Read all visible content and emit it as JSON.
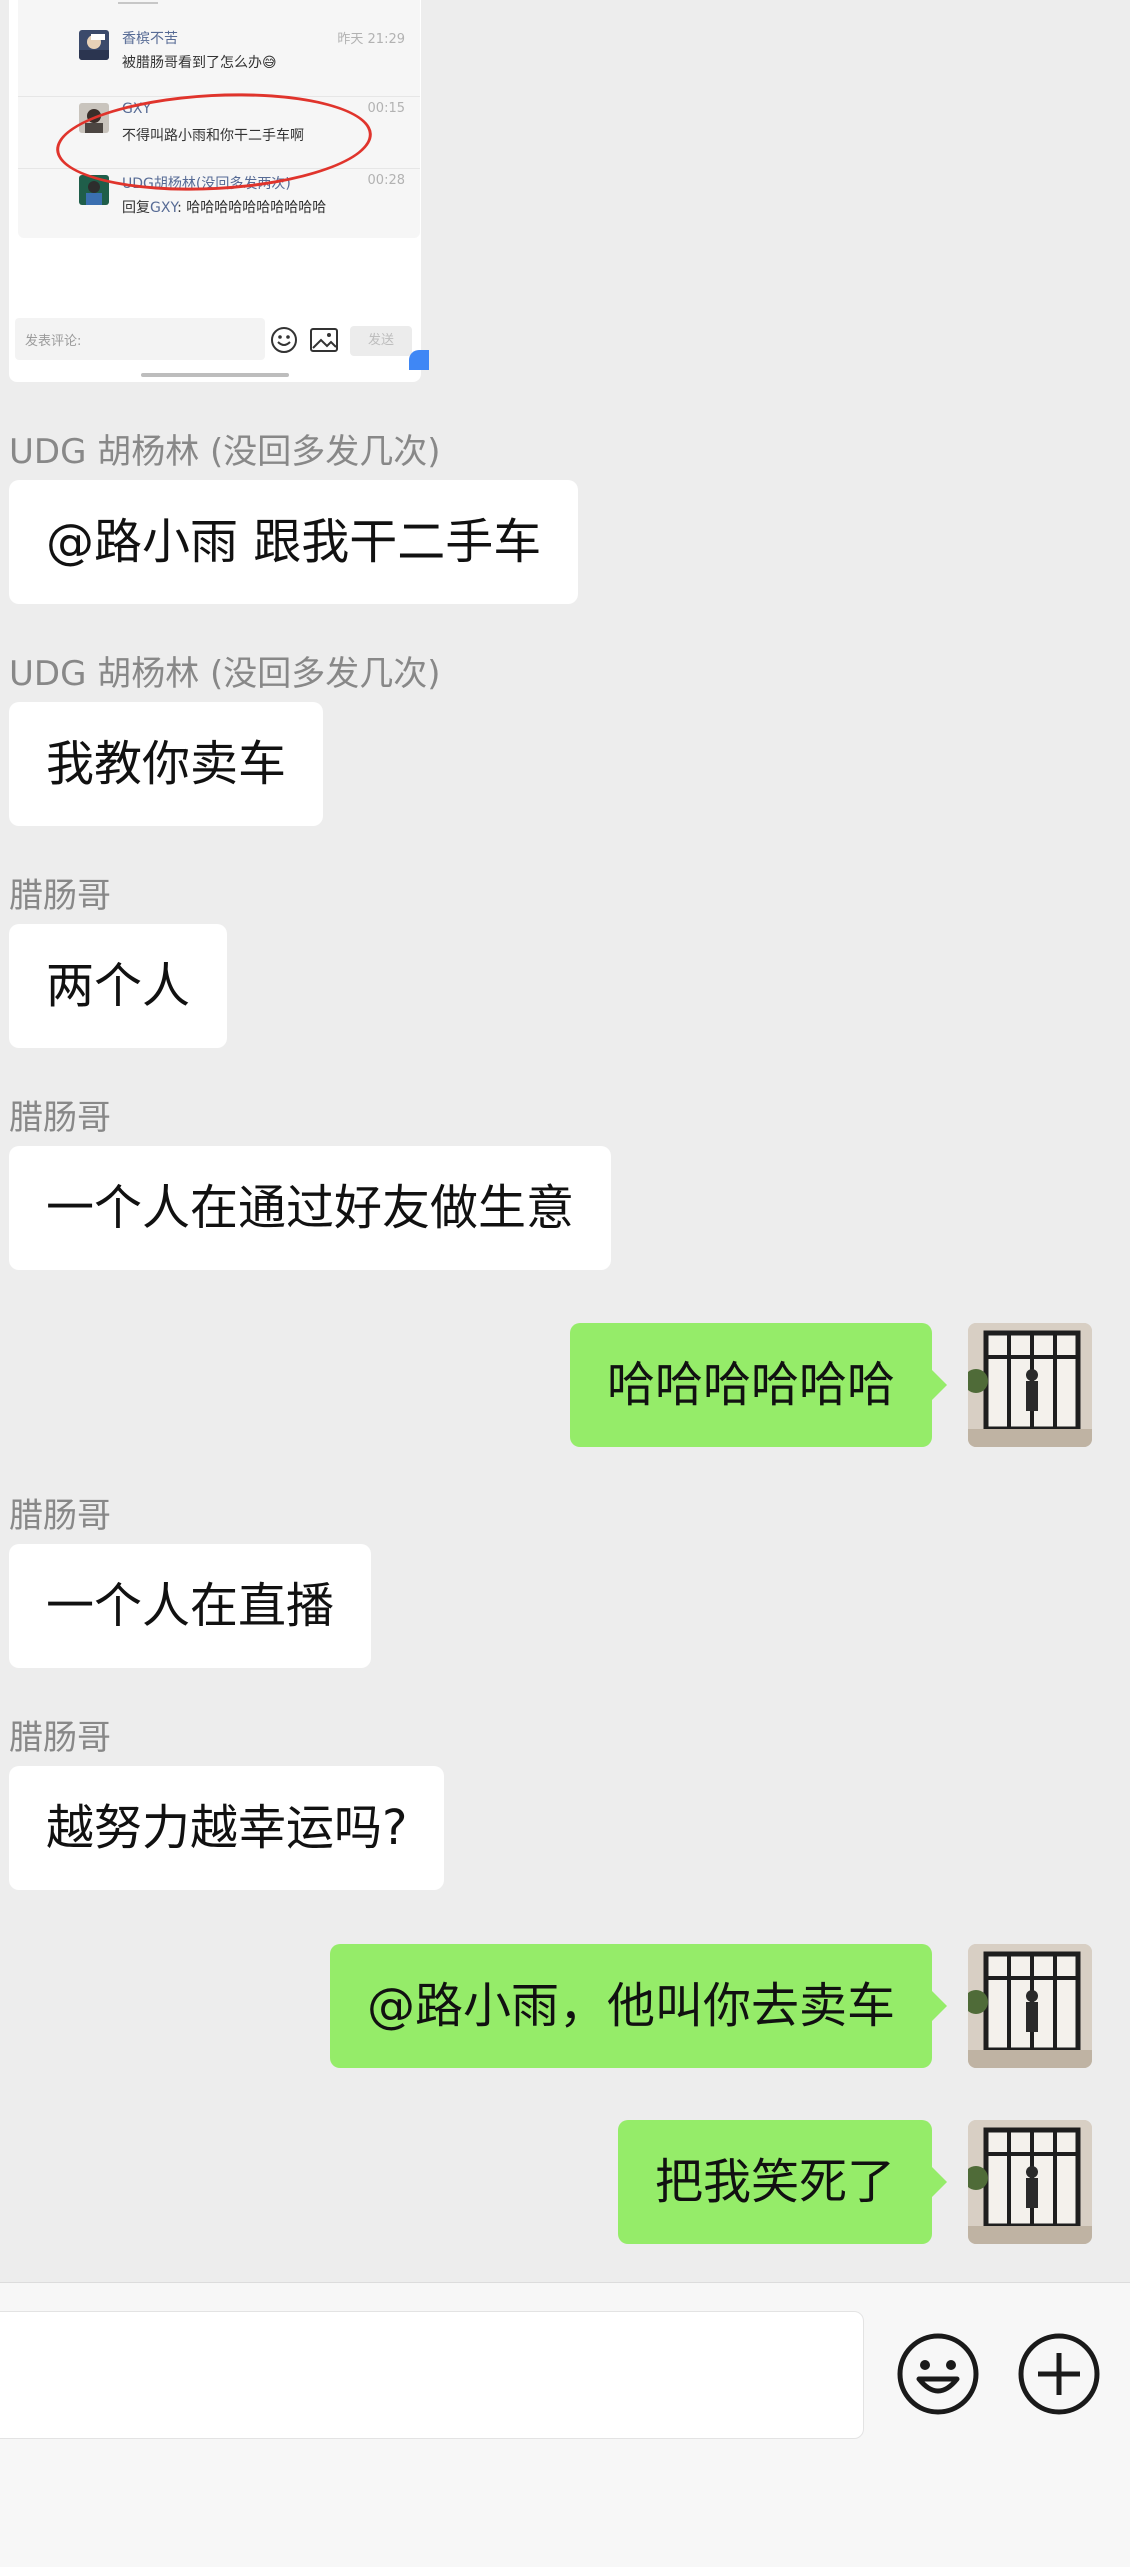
{
  "embedded_screenshot": {
    "comments": [
      {
        "name": "香槟不苦",
        "time": "昨天 21:29",
        "text": "被腊肠哥看到了怎么办😅"
      },
      {
        "name": "GXY",
        "time": "00:15",
        "text": "不得叫路小雨和你干二手车啊"
      },
      {
        "name": "UDG胡杨林(没回多发两次)",
        "time": "00:28",
        "reply_prefix": "回复",
        "reply_name": "GXY",
        "reply_text": ": 哈哈哈哈哈哈哈哈哈哈"
      }
    ],
    "input_placeholder": "发表评论:",
    "send_label": "发送"
  },
  "messages": [
    {
      "sender": "UDG 胡杨林 (没回多发几次)",
      "text": "@路小雨 跟我干二手车"
    },
    {
      "sender": "UDG 胡杨林 (没回多发几次)",
      "text": "我教你卖车"
    },
    {
      "sender": "腊肠哥",
      "text": "两个人"
    },
    {
      "sender": "腊肠哥",
      "text": "一个人在通过好友做生意"
    },
    {
      "self": true,
      "text": "哈哈哈哈哈哈"
    },
    {
      "sender": "腊肠哥",
      "text": "一个人在直播"
    },
    {
      "sender": "腊肠哥",
      "text": "越努力越幸运吗?"
    },
    {
      "self": true,
      "text": "@路小雨，他叫你去卖车"
    },
    {
      "self": true,
      "text": "把我笑死了"
    }
  ],
  "input_bar": {
    "emoji_icon": "smiley-icon",
    "plus_icon": "plus-circle-icon"
  },
  "colors": {
    "background": "#ededed",
    "self_bubble": "#95ec69",
    "other_bubble": "#ffffff",
    "link_name": "#576b95",
    "circle_annotation": "#e0342c"
  }
}
